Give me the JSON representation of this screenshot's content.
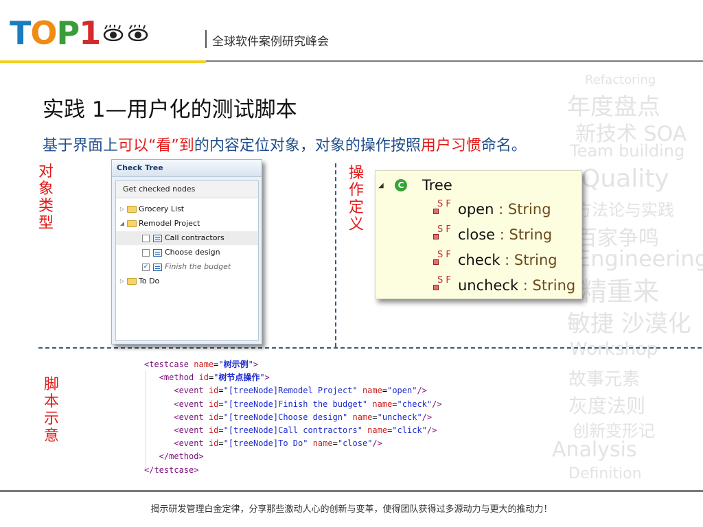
{
  "header": {
    "logo_text": "TOP1",
    "tagline": "全球软件案例研究峰会"
  },
  "watermark_words": [
    "Refactoring",
    "年度盘点",
    "新技术 SOA",
    "Team building",
    "Quality",
    "方法论与实践",
    "百家争鸣",
    "Engineering",
    "精重来",
    "敏捷 沙漠化",
    "Workshop",
    "故事元素",
    "灰度法则",
    "创新变形记",
    "Analysis",
    "Definition"
  ],
  "slide": {
    "title": "实践 1—用户化的测试脚本",
    "subtitle": {
      "p1": "基于界面上",
      "h1": "可以“看”到",
      "p2": "的内容定位对象，对象的操作按照",
      "h2": "用户习惯",
      "p3": "命名。"
    }
  },
  "labels": {
    "object_type": [
      "对",
      "象",
      "类",
      "型"
    ],
    "operation_def": [
      "操",
      "作",
      "定",
      "义"
    ],
    "script_demo": [
      "脚",
      "本",
      "示",
      "意"
    ]
  },
  "check_tree": {
    "title": "Check Tree",
    "button": "Get checked nodes",
    "nodes": [
      {
        "label": "Grocery List"
      },
      {
        "label": "Remodel Project"
      },
      {
        "label": "Call contractors",
        "checked": false
      },
      {
        "label": "Choose design",
        "checked": false
      },
      {
        "label": "Finish the budget",
        "checked": true
      },
      {
        "label": "To Do"
      }
    ]
  },
  "outline": {
    "class_name": "Tree",
    "field_badge": "S F",
    "fields": [
      {
        "name": "open",
        "type": ": String"
      },
      {
        "name": "close",
        "type": ": String"
      },
      {
        "name": "check",
        "type": ": String"
      },
      {
        "name": "uncheck",
        "type": ": String"
      }
    ]
  },
  "xml": {
    "testcase_name": "树示例",
    "method_id": "树节点操作",
    "events": [
      {
        "id": "[treeNode]Remodel Project",
        "name": "open"
      },
      {
        "id": "[treeNode]Finish the budget",
        "name": "check"
      },
      {
        "id": "[treeNode]Choose design",
        "name": "uncheck"
      },
      {
        "id": "[treeNode]Call contractors",
        "name": "click"
      },
      {
        "id": "[treeNode]To Do",
        "name": "close"
      }
    ]
  },
  "footer": "揭示研发管理白金定律，分享那些激动人心的创新与变革，使得团队获得过多源动力与更大的推动力！"
}
